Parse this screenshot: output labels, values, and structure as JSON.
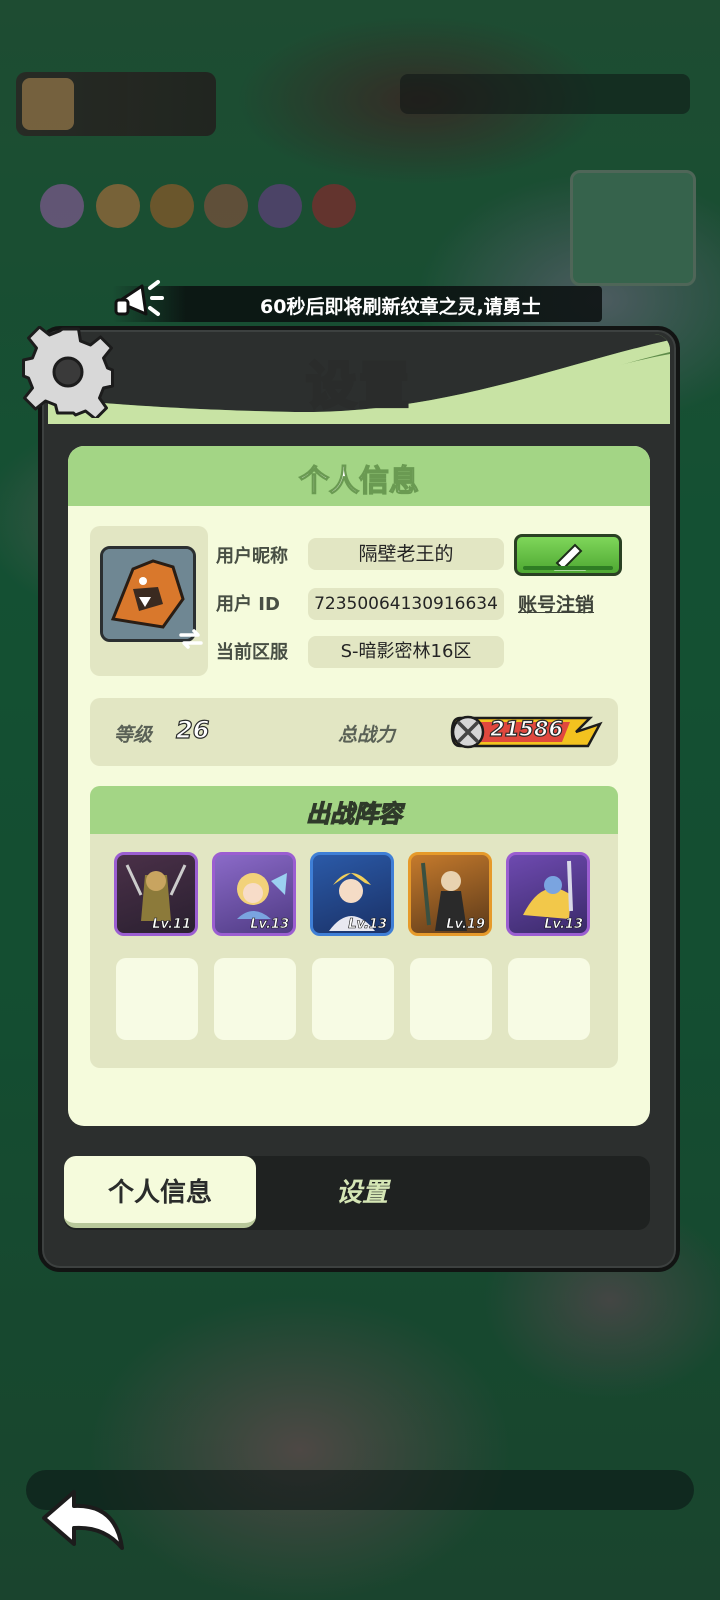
{
  "announcement": {
    "text": "60秒后即将刷新纹章之灵,请勇士"
  },
  "panel": {
    "title": "设置"
  },
  "profile": {
    "section_title": "个人信息",
    "nickname_label": "用户昵称",
    "nickname": "隔壁老王的",
    "id_label": "用户  ID",
    "user_id": "72350064130916634",
    "logout_label": "账号注销",
    "server_label": "当前区服",
    "server": "S-暗影密林16区",
    "level_label": "等级",
    "level": "26",
    "power_label": "总战力",
    "power": "21586"
  },
  "lineup": {
    "title": "出战阵容",
    "heroes": [
      {
        "level": "Lv.11",
        "frame_color": "#9b5ed1"
      },
      {
        "level": "Lv.13",
        "frame_color": "#9b5ed1"
      },
      {
        "level": "Lv.13",
        "frame_color": "#3f7fd6"
      },
      {
        "level": "Lv.19",
        "frame_color": "#e69a2a"
      },
      {
        "level": "Lv.13",
        "frame_color": "#9b5ed1"
      }
    ],
    "empty_slots": 5
  },
  "tabs": [
    {
      "label": "个人信息",
      "active": true
    },
    {
      "label": "设置",
      "active": false
    }
  ],
  "icons": {
    "gear": "gear-icon",
    "speaker": "megaphone-icon",
    "edit": "pencil-icon",
    "swap": "swap-icon",
    "back": "back-arrow-icon",
    "power": "crossed-swords-icon"
  },
  "colors": {
    "panel_bg": "#2c2f2e",
    "content_bg": "#f5fbdc",
    "header_green": "#a3d585",
    "button_green": "#5cbc3c"
  }
}
